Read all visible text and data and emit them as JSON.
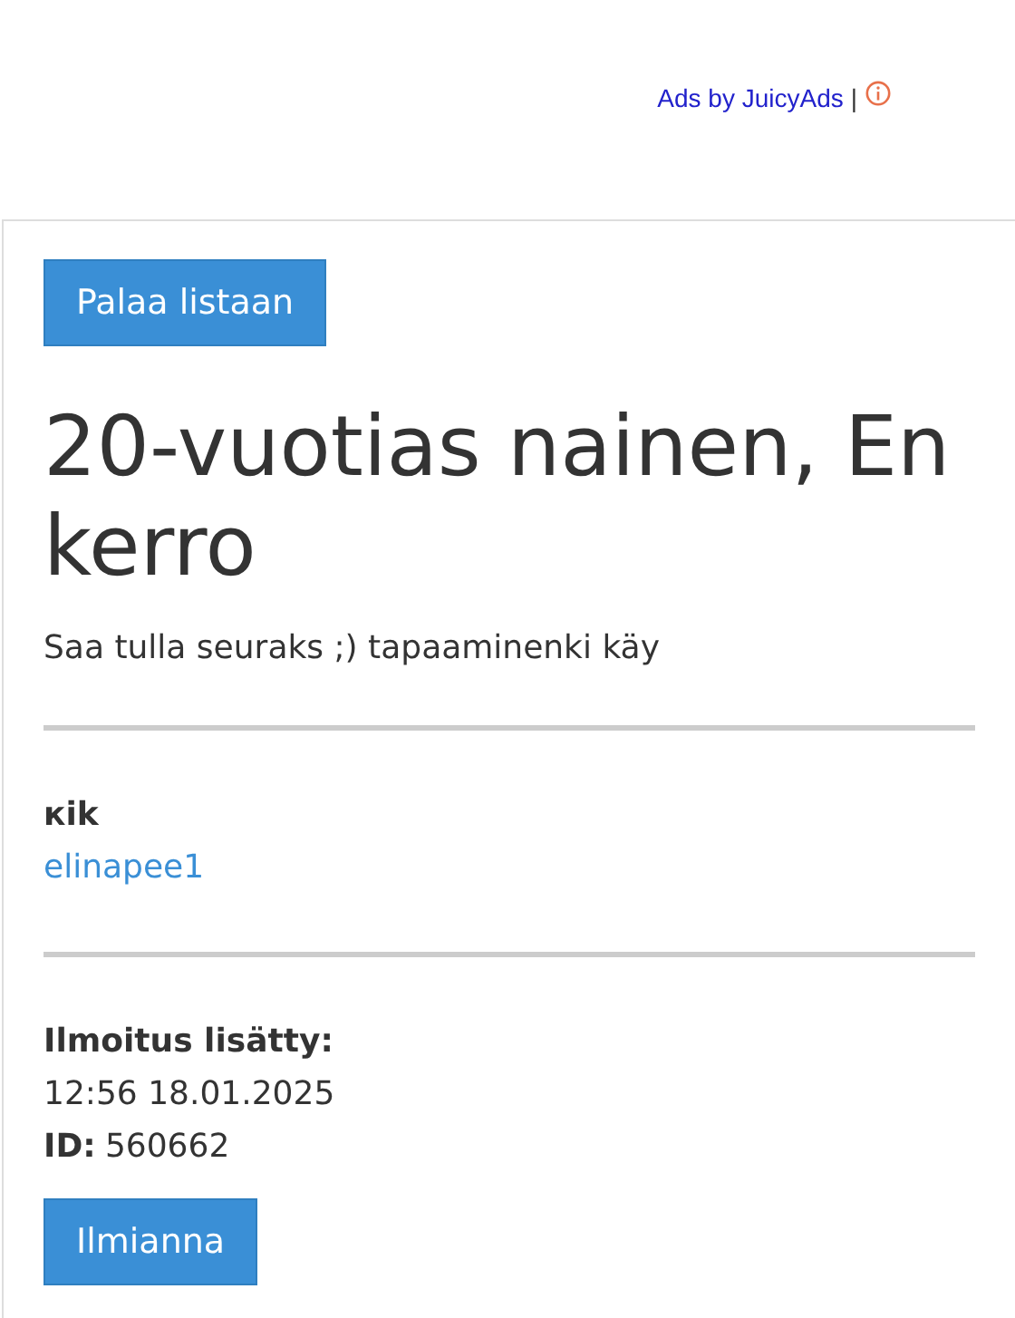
{
  "ad_bar": {
    "text": "Ads by JuicyAds",
    "separator": "|"
  },
  "back_button": "Palaa listaan",
  "title": "20-vuotias nainen, En kerro",
  "description": "Saa tulla seuraks ;) tapaaminenki käy",
  "contact": {
    "label": "кik",
    "value": "elinapee1"
  },
  "meta": [
    {
      "label": "Ilmoitus lisätty:",
      "value": "12:56 18.01.2025",
      "kind": "block"
    },
    {
      "label": "ID:",
      "value": "560662",
      "kind": "inline"
    }
  ],
  "report_button": "Ilmianna"
}
